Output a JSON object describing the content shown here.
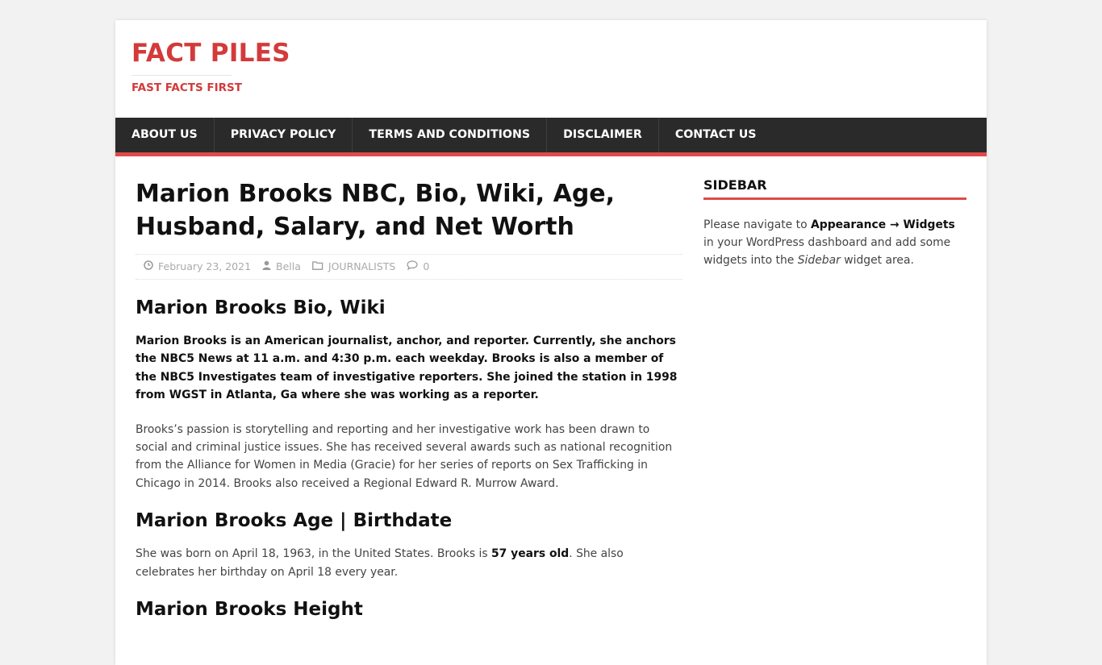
{
  "site": {
    "title": "FACT PILES",
    "tagline": "FAST FACTS FIRST"
  },
  "nav": [
    {
      "label": "ABOUT US"
    },
    {
      "label": "PRIVACY POLICY"
    },
    {
      "label": "TERMS AND CONDITIONS"
    },
    {
      "label": "DISCLAIMER"
    },
    {
      "label": "CONTACT US"
    }
  ],
  "post": {
    "title": "Marion Brooks NBC, Bio, Wiki, Age, Husband, Salary, and Net Worth",
    "meta": {
      "date": "February 23, 2021",
      "author": "Bella",
      "category": "JOURNALISTS",
      "comments": "0"
    },
    "sections": {
      "bio_heading": "Marion Brooks Bio, Wiki",
      "bio_intro": "Marion Brooks is an American journalist, anchor, and reporter. Currently, she anchors the NBC5 News at 11 a.m. and 4:30 p.m. each weekday. Brooks is also a member of the NBC5 Investigates team of investigative reporters. She joined the station in 1998 from WGST in Atlanta, Ga where she was working as a reporter.",
      "bio_body": "Brooks’s passion is storytelling and reporting and her investigative work has been drawn to social and criminal justice issues. She has received several awards such as national recognition from the Alliance for Women in Media (Gracie) for her series of reports on Sex Trafficking in Chicago in 2014. Brooks also received a Regional Edward R. Murrow Award.",
      "age_heading": "Marion Brooks Age | Birthdate",
      "age_before": "She was born on April 18, 1963, in the United States. Brooks is ",
      "age_bold": "57 years old",
      "age_after": ". She also celebrates her birthday on April 18 every year.",
      "height_heading": "Marion Brooks Height"
    }
  },
  "sidebar": {
    "title": "SIDEBAR",
    "text_1": "Please navigate to ",
    "bold_1": "Appearance → Widgets",
    "text_2": " in your WordPress dashboard and add some widgets into the ",
    "italic_1": "Sidebar",
    "text_3": " widget area."
  }
}
